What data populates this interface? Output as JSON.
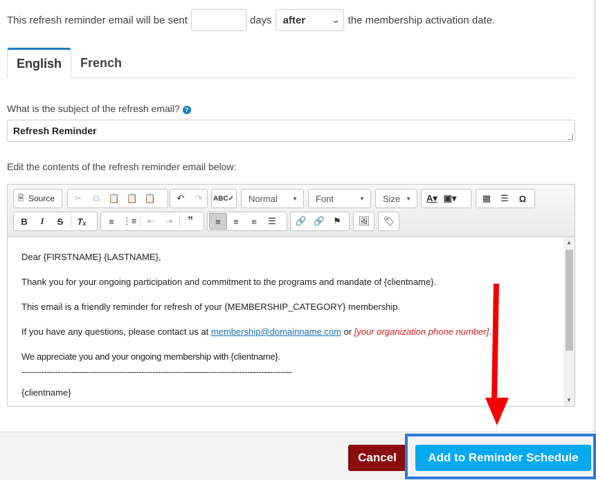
{
  "schedule": {
    "prefix": "This refresh reminder email will be sent",
    "days_value": "",
    "days_label": "days",
    "timing_value": "after",
    "suffix": "the membership activation date."
  },
  "tabs": [
    {
      "label": "English",
      "active": true
    },
    {
      "label": "French",
      "active": false
    }
  ],
  "subject": {
    "label": "What is the subject of the refresh email?",
    "value": "Refresh Reminder"
  },
  "body_label": "Edit the contents of the refresh reminder email below:",
  "toolbar": {
    "source_label": "Source",
    "format_value": "Normal",
    "font_value": "Font",
    "size_value": "Size"
  },
  "email_body": {
    "greeting": "Dear {FIRSTNAME} {LASTNAME},",
    "thanks": "Thank you for your ongoing participation and commitment to the programs and mandate of {clientname}.",
    "reminder": "This email is a friendly reminder for refresh of your {MEMBERSHIP_CATEGORY} membership.",
    "contact_prefix": "If you have any questions, please contact us at",
    "contact_email": "membership@domainname.com",
    "contact_or": "or",
    "contact_phone": "[your organization phone number]",
    "contact_end": ".",
    "appreciate": "We appreciate you and your ongoing membership with {clientname}.",
    "divider": "-------------------------------------------------------------------------------------------------",
    "signature": "{clientname}"
  },
  "footer": {
    "cancel_label": "Cancel",
    "add_label": "Add to Reminder Schedule"
  },
  "colors": {
    "accent": "#1a7fc4",
    "cancel": "#8a0c0c",
    "primary": "#05a9f0",
    "highlight_frame": "#2e7ad8",
    "annotation_arrow": "#f40000"
  }
}
